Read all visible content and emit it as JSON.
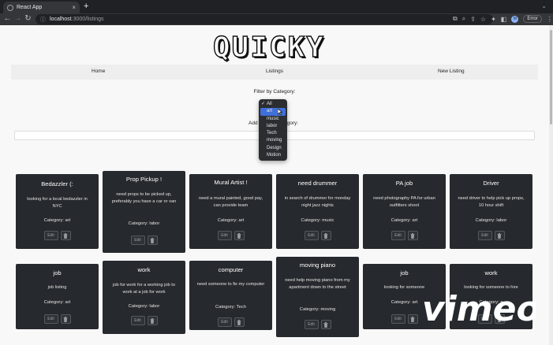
{
  "browser": {
    "tab_title": "React App",
    "url_host": "localhost",
    "url_path": ":3000/listings",
    "error_label": "Error",
    "avatar_initial": "M"
  },
  "site": {
    "logo": "QUICKY",
    "nav": [
      "Home",
      "Listings",
      "New Listing"
    ],
    "filter_label": "Filter by Category:",
    "add_label_start": "Add",
    "add_label_end": "egory:"
  },
  "dropdown": {
    "items": [
      "All",
      "art",
      "music",
      "labor",
      "Tech",
      "moving",
      "Design",
      "Motion"
    ],
    "checked": "All",
    "highlighted": "art"
  },
  "card_labels": {
    "edit": "Edit"
  },
  "listings": [
    {
      "title": "Bedazzler (:",
      "desc": "looking for a local bedazzler in NYC",
      "category": "Category: art"
    },
    {
      "title": "Prop Pickup !",
      "desc": "need props to be picked up, preferably you have a car or van",
      "category": "Category: labor"
    },
    {
      "title": "Mural Artist !",
      "desc": "need a mural painted, good pay, can provide team",
      "category": "Category: art"
    },
    {
      "title": "need drummer",
      "desc": "in search of drummer for monday night jazz nights",
      "category": "Category: music"
    },
    {
      "title": "PA job",
      "desc": "need photography PA for urban outfitters shoot",
      "category": "Category: art"
    },
    {
      "title": "Driver",
      "desc": "need driver to help pick up props, 10 hour shift",
      "category": "Category: labor"
    },
    {
      "title": "job",
      "desc": "job listing",
      "category": "Category: art"
    },
    {
      "title": "work",
      "desc": "job for work for a working job to work at a job for work",
      "category": "Category: labor"
    },
    {
      "title": "computer",
      "desc": "need someone to fix my computer",
      "category": "Category: Tech"
    },
    {
      "title": "moving piano",
      "desc": "need help moving piano from my apartment down to the street",
      "category": "Category: moving"
    },
    {
      "title": "job",
      "desc": "looking for someone",
      "category": "Category: art"
    },
    {
      "title": "work",
      "desc": "looking for someone to hire",
      "category": "Category: a"
    }
  ],
  "watermark": "vimeo",
  "colors": {
    "card_bg": "#26292d",
    "dropdown_highlight": "#3f6fd8",
    "browser_dark": "#202124"
  }
}
